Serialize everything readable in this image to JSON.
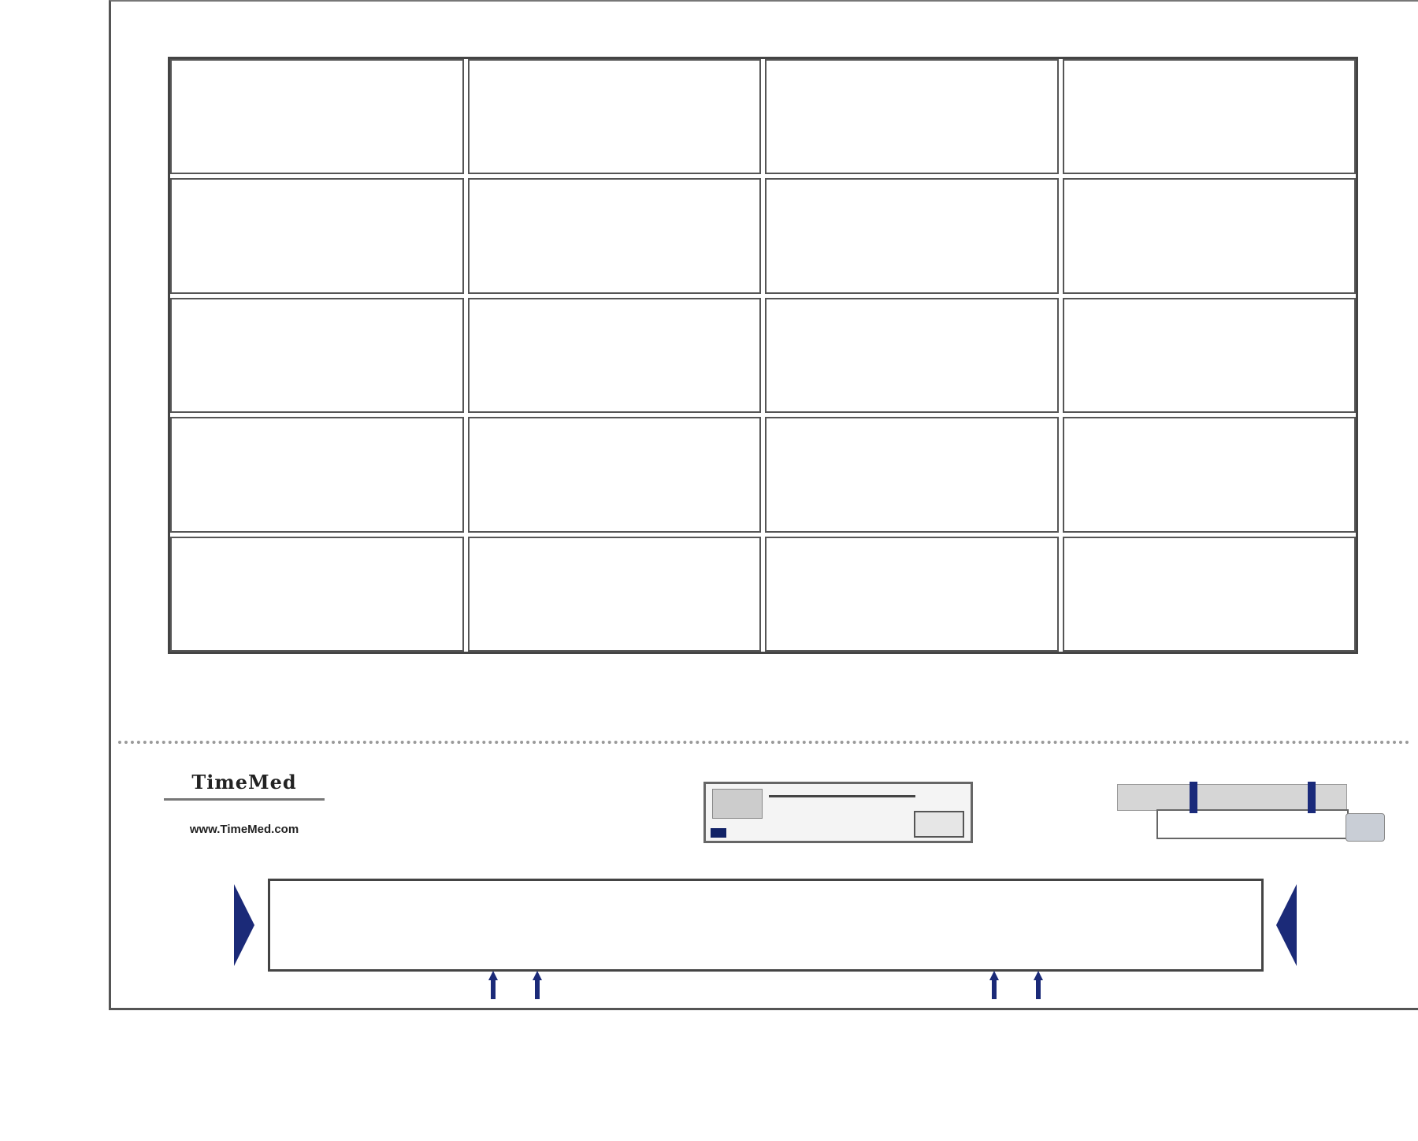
{
  "label_sheet": {
    "rows": 5,
    "columns": 4
  },
  "brand": {
    "name": "TimeMed",
    "url": "www.TimeMed.com"
  },
  "accent_color": "#1b2a78"
}
